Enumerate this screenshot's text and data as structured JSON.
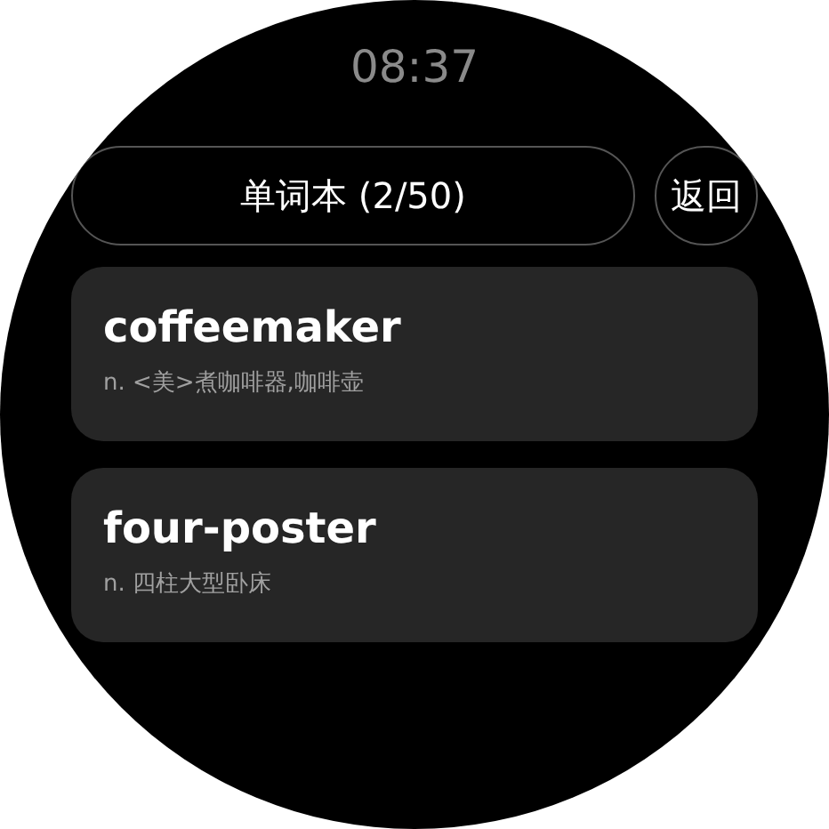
{
  "status_bar": {
    "time": "08:37"
  },
  "header": {
    "title": "单词本 (2/50)",
    "back_button": "返回"
  },
  "words": [
    {
      "word": "coffeemaker",
      "definition": "n. <美>煮咖啡器,咖啡壶"
    },
    {
      "word": "four-poster",
      "definition": "n. 四柱大型卧床"
    }
  ]
}
